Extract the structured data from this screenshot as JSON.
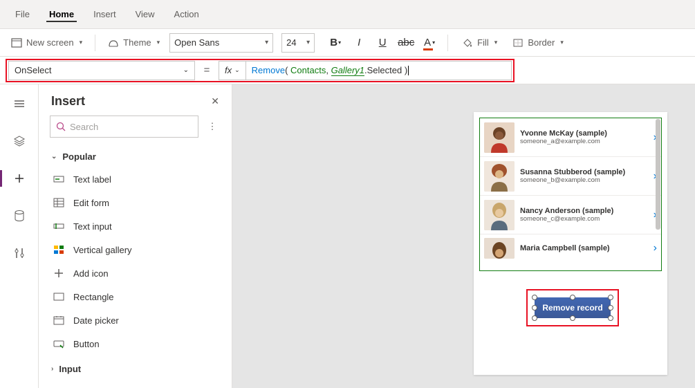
{
  "menubar": {
    "items": [
      "File",
      "Home",
      "Insert",
      "View",
      "Action"
    ],
    "active": "Home"
  },
  "toolbar": {
    "newScreen": "New screen",
    "theme": "Theme",
    "fontFamily": "Open Sans",
    "fontSize": "24",
    "fill": "Fill",
    "border": "Border"
  },
  "formulaBar": {
    "property": "OnSelect",
    "fx": "fx",
    "tokens": {
      "fn": "Remove",
      "lp": "( ",
      "ds": "Contacts",
      "comma": ", ",
      "ctl": "Gallery1",
      "dot": ".Selected ",
      "rp": ")"
    }
  },
  "insertPanel": {
    "title": "Insert",
    "searchPlaceholder": "Search",
    "sections": {
      "popular": {
        "label": "Popular",
        "items": [
          {
            "icon": "text-label",
            "label": "Text label"
          },
          {
            "icon": "form",
            "label": "Edit form"
          },
          {
            "icon": "text-input",
            "label": "Text input"
          },
          {
            "icon": "gallery",
            "label": "Vertical gallery"
          },
          {
            "icon": "plus",
            "label": "Add icon"
          },
          {
            "icon": "rect",
            "label": "Rectangle"
          },
          {
            "icon": "date",
            "label": "Date picker"
          },
          {
            "icon": "button",
            "label": "Button"
          }
        ]
      },
      "input": {
        "label": "Input"
      }
    }
  },
  "canvas": {
    "galleryRows": [
      {
        "name": "Yvonne McKay (sample)",
        "email": "someone_a@example.com"
      },
      {
        "name": "Susanna Stubberod (sample)",
        "email": "someone_b@example.com"
      },
      {
        "name": "Nancy Anderson (sample)",
        "email": "someone_c@example.com"
      },
      {
        "name": "Maria Campbell (sample)",
        "email": ""
      }
    ],
    "buttonLabel": "Remove record"
  }
}
